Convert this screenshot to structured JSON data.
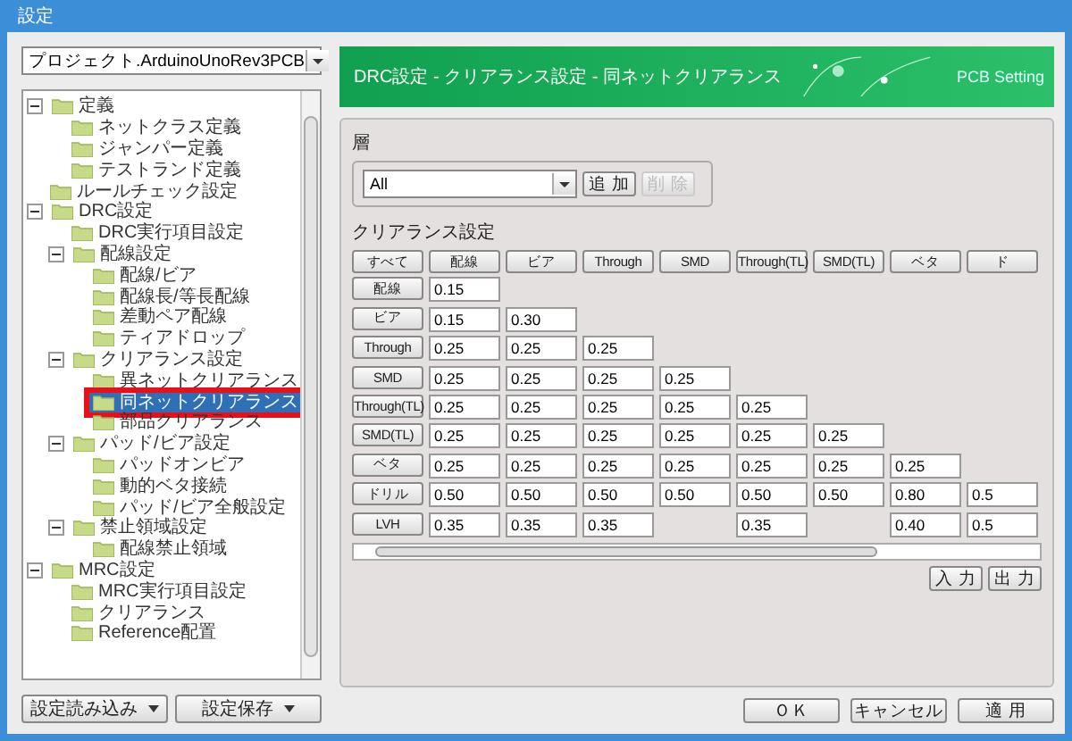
{
  "window": {
    "title": "設定"
  },
  "project_select": {
    "value": "プロジェクト.ArduinoUnoRev3PCB"
  },
  "tree": [
    {
      "label": "定義",
      "expanded": true,
      "selected": false,
      "children": [
        {
          "label": "ネットクラス定義",
          "selected": false
        },
        {
          "label": "ジャンパー定義",
          "selected": false
        },
        {
          "label": "テストランド定義",
          "selected": false
        }
      ]
    },
    {
      "label": "ルールチェック設定",
      "selected": false
    },
    {
      "label": "DRC設定",
      "expanded": true,
      "selected": false,
      "children": [
        {
          "label": "DRC実行項目設定",
          "selected": false
        },
        {
          "label": "配線設定",
          "expanded": true,
          "selected": false,
          "children": [
            {
              "label": "配線/ビア",
              "selected": false
            },
            {
              "label": "配線長/等長配線",
              "selected": false
            },
            {
              "label": "差動ペア配線",
              "selected": false
            },
            {
              "label": "ティアドロップ",
              "selected": false
            }
          ]
        },
        {
          "label": "クリアランス設定",
          "expanded": true,
          "selected": false,
          "children": [
            {
              "label": "異ネットクリアランス",
              "selected": false
            },
            {
              "label": "同ネットクリアランス",
              "selected": true
            },
            {
              "label": "部品クリアランス",
              "selected": false
            }
          ]
        },
        {
          "label": "パッド/ビア設定",
          "expanded": true,
          "selected": false,
          "children": [
            {
              "label": "パッドオンビア",
              "selected": false
            },
            {
              "label": "動的ベタ接続",
              "selected": false
            },
            {
              "label": "パッド/ビア全般設定",
              "selected": false
            }
          ]
        },
        {
          "label": "禁止領域設定",
          "expanded": true,
          "selected": false,
          "children": [
            {
              "label": "配線禁止領域",
              "selected": false
            }
          ]
        }
      ]
    },
    {
      "label": "MRC設定",
      "expanded": true,
      "selected": false,
      "children": [
        {
          "label": "MRC実行項目設定",
          "selected": false
        },
        {
          "label": "クリアランス",
          "selected": false
        },
        {
          "label": "Reference配置",
          "selected": false
        }
      ]
    }
  ],
  "left_buttons": [
    "設定読み込み",
    "設定保存"
  ],
  "header": {
    "title": "DRC設定 - クリアランス設定 - 同ネットクリアランス",
    "brand": "PCB Setting"
  },
  "layer": {
    "label": "層",
    "value": "All",
    "buttons": [
      {
        "label": "追 加",
        "disabled": false
      },
      {
        "label": "削 除",
        "disabled": true
      }
    ]
  },
  "clearance": {
    "label": "クリアランス設定",
    "columns": [
      "すべて",
      "配線",
      "ビア",
      "Through",
      "SMD",
      "Through(TL)",
      "SMD(TL)",
      "ベタ",
      "ド"
    ],
    "rows": [
      {
        "label": "配線",
        "values": [
          "0.15"
        ]
      },
      {
        "label": "ビア",
        "values": [
          "0.15",
          "0.30"
        ]
      },
      {
        "label": "Through",
        "values": [
          "0.25",
          "0.25",
          "0.25"
        ]
      },
      {
        "label": "SMD",
        "values": [
          "0.25",
          "0.25",
          "0.25",
          "0.25"
        ]
      },
      {
        "label": "Through(TL)",
        "values": [
          "0.25",
          "0.25",
          "0.25",
          "0.25",
          "0.25"
        ]
      },
      {
        "label": "SMD(TL)",
        "values": [
          "0.25",
          "0.25",
          "0.25",
          "0.25",
          "0.25",
          "0.25"
        ]
      },
      {
        "label": "ベタ",
        "values": [
          "0.25",
          "0.25",
          "0.25",
          "0.25",
          "0.25",
          "0.25",
          "0.25"
        ]
      },
      {
        "label": "ドリル",
        "values": [
          "0.50",
          "0.50",
          "0.50",
          "0.50",
          "0.50",
          "0.50",
          "0.80",
          "0.5"
        ]
      },
      {
        "label": "LVH",
        "cells": [
          {
            "value": "0.35",
            "empty": false
          },
          {
            "value": "0.35",
            "empty": false
          },
          {
            "value": "0.35",
            "empty": false
          },
          {
            "empty": true
          },
          {
            "value": "0.35",
            "empty": false
          },
          {
            "empty": true
          },
          {
            "value": "0.40",
            "empty": false
          },
          {
            "value": "0.5",
            "empty": false
          }
        ]
      }
    ],
    "buttons": [
      "入 力",
      "出 力"
    ]
  },
  "footer_buttons": [
    "ＯＫ",
    "キャンセル",
    "適 用"
  ]
}
